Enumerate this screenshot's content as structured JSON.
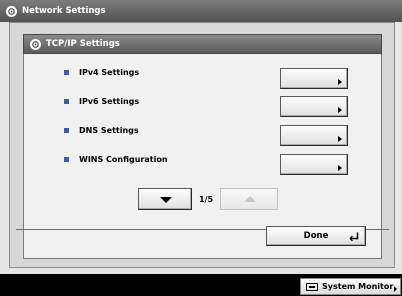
{
  "window": {
    "title": "Network Settings"
  },
  "dialog": {
    "title": "TCP/IP Settings"
  },
  "settings": [
    {
      "label": "IPv4 Settings"
    },
    {
      "label": "IPv6 Settings"
    },
    {
      "label": "DNS Settings"
    },
    {
      "label": "WINS Configuration"
    }
  ],
  "pagination": {
    "indicator": "1/5"
  },
  "actions": {
    "done_label": "Done"
  },
  "footer": {
    "system_monitor_label": "System Monitor"
  },
  "icons": {
    "header_icon": "network-gear-icon",
    "chevron": "chevron-right-icon",
    "page_down": "arrow-down-icon",
    "page_up": "arrow-up-icon",
    "enter": "enter-icon",
    "monitor": "monitor-icon"
  },
  "colors": {
    "bullet": "#3e5ea8",
    "header": "#5a5a5a"
  }
}
